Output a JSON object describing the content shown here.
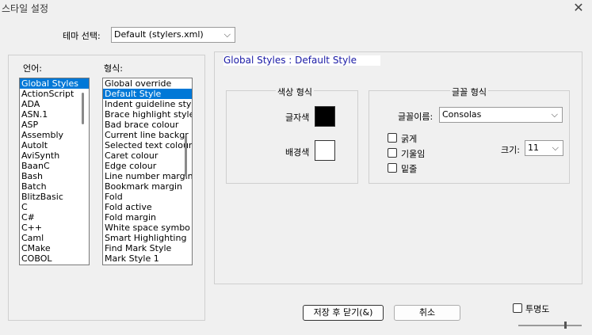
{
  "window": {
    "title": "스타일 설정",
    "close_symbol": "✕"
  },
  "theme": {
    "label": "테마 선택:",
    "selected": "Default (stylers.xml)"
  },
  "language": {
    "label": "언어:",
    "items": [
      "Global Styles",
      "ActionScript",
      "ADA",
      "ASN.1",
      "ASP",
      "Assembly",
      "AutoIt",
      "AviSynth",
      "BaanC",
      "Bash",
      "Batch",
      "BlitzBasic",
      "C",
      "C#",
      "C++",
      "Caml",
      "CMake",
      "COBOL"
    ],
    "selected_index": 0
  },
  "style": {
    "label": "형식:",
    "items": [
      "Global override",
      "Default Style",
      "Indent guideline sty",
      "Brace highlight style",
      "Bad brace colour",
      "Current line backgr",
      "Selected text colour",
      "Caret colour",
      "Edge colour",
      "Line number margin",
      "Bookmark margin",
      "Fold",
      "Fold active",
      "Fold margin",
      "White space symbo",
      "Smart Highlighting",
      "Find Mark Style",
      "Mark Style 1"
    ],
    "selected_index": 1
  },
  "panel": {
    "header": "Global Styles : Default Style"
  },
  "color_group": {
    "title": "색상 형식",
    "fg_label": "글자색",
    "bg_label": "배경색",
    "fg_color": "#000000",
    "bg_color": "#ffffff"
  },
  "font_group": {
    "title": "글꼴 형식",
    "name_label": "글꼴이름:",
    "name_value": "Consolas",
    "size_label": "크기:",
    "size_value": "11",
    "bold": "굵게",
    "italic": "기울임",
    "underline": "밑줄"
  },
  "buttons": {
    "save_close": "저장 후 닫기(&)",
    "cancel": "취소"
  },
  "transparency": {
    "label": "투명도"
  },
  "icons": {
    "chevron": "⌵"
  }
}
